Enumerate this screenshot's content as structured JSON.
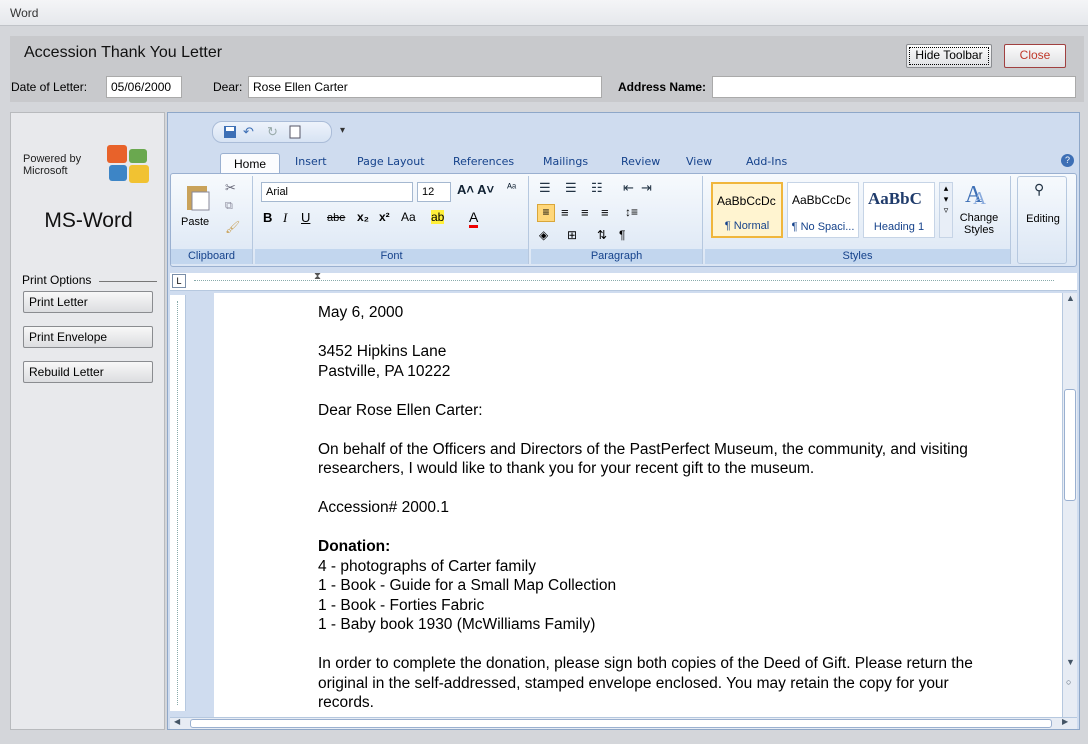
{
  "window": {
    "title": "Word"
  },
  "header": {
    "title": "Accession Thank You Letter",
    "hide_toolbar": "Hide Toolbar",
    "close": "Close",
    "date_label": "Date of Letter:",
    "date_value": "05/06/2000",
    "dear_label": "Dear:",
    "dear_value": "Rose Ellen Carter",
    "address_label": "Address Name:",
    "address_value": ""
  },
  "sidebar": {
    "powered_by": "Powered by",
    "microsoft": "Microsoft",
    "app_name": "MS-Word",
    "print_options": "Print Options",
    "buttons": [
      "Print Letter",
      "Print Envelope",
      "Rebuild Letter"
    ]
  },
  "ribbon": {
    "tabs": [
      "Home",
      "Insert",
      "Page Layout",
      "References",
      "Mailings",
      "Review",
      "View",
      "Add-Ins"
    ],
    "groups": [
      "Clipboard",
      "Font",
      "Paragraph",
      "Styles"
    ],
    "paste": "Paste",
    "font_name": "Arial",
    "font_size": "12",
    "styles": [
      {
        "preview": "AaBbCcDc",
        "name": "¶ Normal"
      },
      {
        "preview": "AaBbCcDc",
        "name": "¶ No Spaci..."
      },
      {
        "preview": "AaBbC",
        "name": "Heading 1"
      }
    ],
    "change_styles": "Change Styles",
    "editing": "Editing"
  },
  "document": {
    "date": "May 6, 2000",
    "address1": "3452 Hipkins Lane",
    "address2": "Pastville, PA 10222",
    "salutation": "Dear Rose Ellen Carter:",
    "para1": "On behalf of the Officers and Directors of the PastPerfect Museum, the community, and visiting researchers, I would like to thank you for your recent gift to the museum.",
    "accession": "Accession# 2000.1",
    "donation_heading": "Donation:",
    "items": [
      "4 - photographs of Carter family",
      "1 - Book - Guide for a Small Map Collection",
      "1 - Book - Forties Fabric",
      "1 - Baby book 1930 (McWilliams Family)"
    ],
    "para2": "In order to complete the donation, please sign both copies of the Deed of Gift.  Please return the original in the self-addressed, stamped envelope enclosed.  You may retain the copy for your records."
  }
}
